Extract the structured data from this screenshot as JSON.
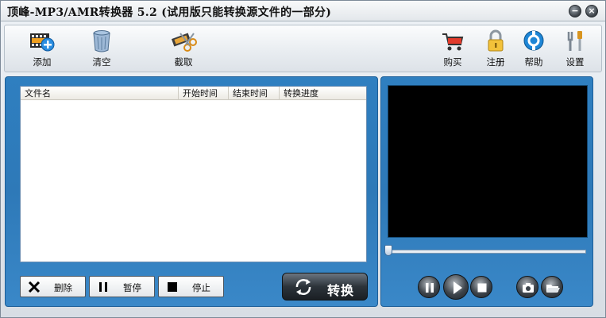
{
  "window": {
    "title": "顶峰-MP3/AMR转换器 5.2 (试用版只能转换源文件的一部分)",
    "minimize_glyph": "−",
    "close_glyph": "×"
  },
  "toolbar": {
    "add_label": "添加",
    "clear_label": "清空",
    "cut_label": "截取",
    "buy_label": "购买",
    "register_label": "注册",
    "help_label": "帮助",
    "settings_label": "设置"
  },
  "file_list": {
    "columns": [
      "文件名",
      "开始时间",
      "结束时间",
      "转换进度"
    ],
    "rows": []
  },
  "actions": {
    "delete_label": "删除",
    "pause_label": "暂停",
    "stop_label": "停止",
    "convert_label": "转换"
  },
  "player": {
    "seek_progress": 0.0
  },
  "icons": [
    "film-add-icon",
    "trash-can-icon",
    "scissors-film-icon",
    "cart-icon",
    "lock-icon",
    "help-circle-icon",
    "tools-icon",
    "close-x-icon",
    "pause-bars-icon",
    "stop-square-icon",
    "refresh-arrows-icon",
    "camera-icon",
    "folder-open-icon",
    "play-icon"
  ],
  "colors": {
    "panel_blue": "#2f7fc0",
    "video_background": "#000000"
  }
}
